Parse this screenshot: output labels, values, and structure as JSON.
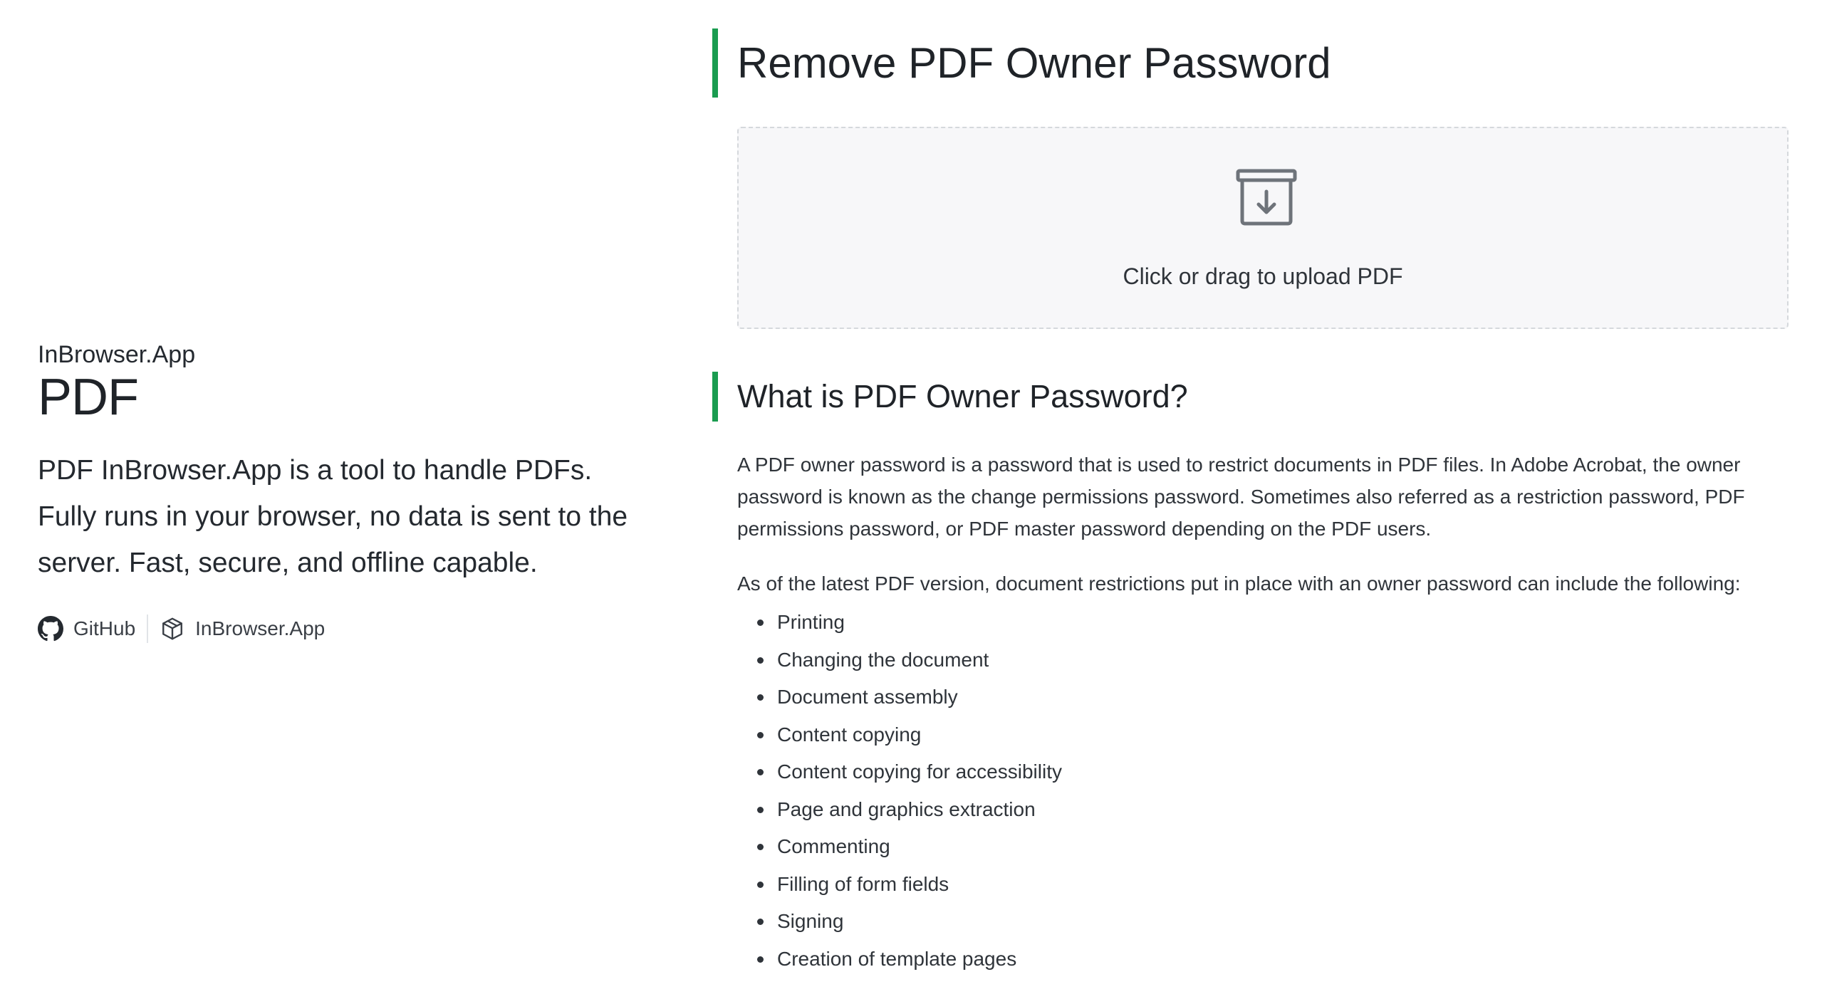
{
  "sidebar": {
    "brand": "InBrowser.App",
    "product": "PDF",
    "tagline": "PDF InBrowser.App is a tool to handle PDFs. Fully runs in your browser, no data is sent to the server. Fast, secure, and offline capable.",
    "links": [
      {
        "label": "GitHub",
        "icon": "github-icon"
      },
      {
        "label": "InBrowser.App",
        "icon": "cube-icon"
      }
    ]
  },
  "main": {
    "title": "Remove PDF Owner Password",
    "upload": {
      "label": "Click or drag to upload PDF",
      "icon": "archive-download-icon"
    },
    "section": {
      "heading": "What is PDF Owner Password?",
      "paragraph1": "A PDF owner password is a password that is used to restrict documents in PDF files. In Adobe Acrobat, the owner password is known as the change permissions password. Sometimes also referred as a restriction password, PDF permissions password, or PDF master password depending on the PDF users.",
      "paragraph2": "As of the latest PDF version, document restrictions put in place with an owner password can include the following:",
      "restrictions": [
        "Printing",
        "Changing the document",
        "Document assembly",
        "Content copying",
        "Content copying for accessibility",
        "Page and graphics extraction",
        "Commenting",
        "Filling of form fields",
        "Signing",
        "Creation of template pages"
      ]
    }
  },
  "colors": {
    "accent": "#1a9c50",
    "text": "#24292f",
    "dropzone_bg": "#f7f7f9",
    "dropzone_border": "#d5d8dc"
  }
}
